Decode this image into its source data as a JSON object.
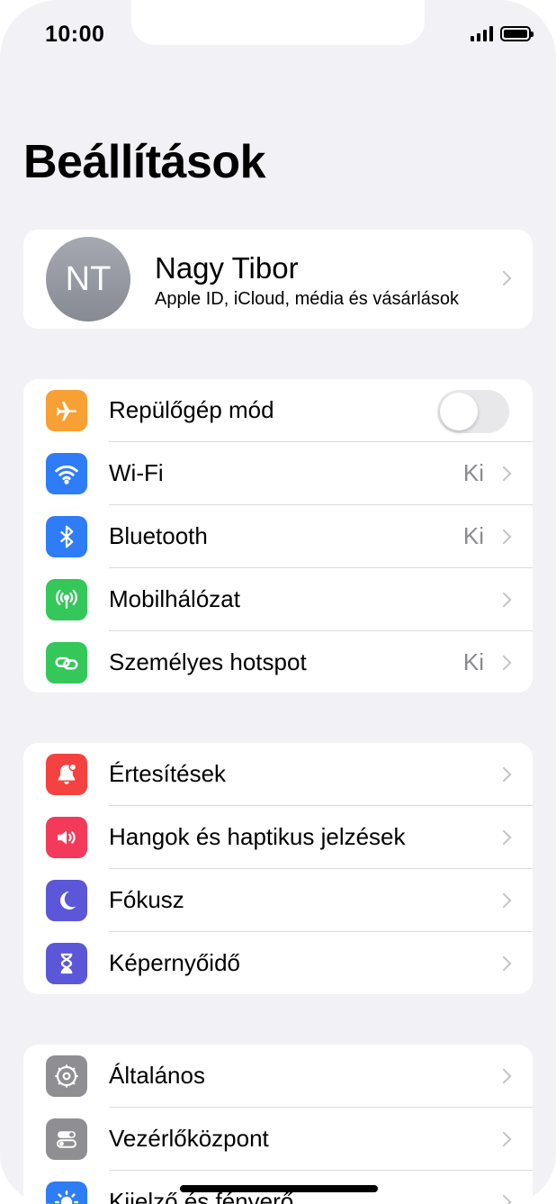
{
  "status": {
    "time": "10:00"
  },
  "title": "Beállítások",
  "profile": {
    "initials": "NT",
    "name": "Nagy Tibor",
    "subtitle": "Apple ID, iCloud, média és vásárlások"
  },
  "group1": [
    {
      "label": "Repülőgép mód",
      "icon": "airplane-icon",
      "color": "#f7a033",
      "control": "toggle",
      "on": false
    },
    {
      "label": "Wi-Fi",
      "icon": "wifi-icon",
      "color": "#2e7cf6",
      "value": "Ki"
    },
    {
      "label": "Bluetooth",
      "icon": "bluetooth-icon",
      "color": "#2e7cf6",
      "value": "Ki"
    },
    {
      "label": "Mobilhálózat",
      "icon": "antenna-icon",
      "color": "#34c759",
      "value": ""
    },
    {
      "label": "Személyes hotspot",
      "icon": "hotspot-link-icon",
      "color": "#34c759",
      "value": "Ki"
    }
  ],
  "group2": [
    {
      "label": "Értesítések",
      "icon": "bell-icon",
      "color": "#f5413f"
    },
    {
      "label": "Hangok és haptikus jelzések",
      "icon": "speaker-icon",
      "color": "#f43a5b"
    },
    {
      "label": "Fókusz",
      "icon": "moon-icon",
      "color": "#5b57d8"
    },
    {
      "label": "Képernyőidő",
      "icon": "hourglass-icon",
      "color": "#5b57d8"
    }
  ],
  "group3": [
    {
      "label": "Általános",
      "icon": "gear-icon",
      "color": "#8e8e93"
    },
    {
      "label": "Vezérlőközpont",
      "icon": "switches-icon",
      "color": "#8e8e93"
    },
    {
      "label": "Kijelző és fényerő",
      "icon": "brightness-icon",
      "color": "#2e7cf6"
    }
  ]
}
